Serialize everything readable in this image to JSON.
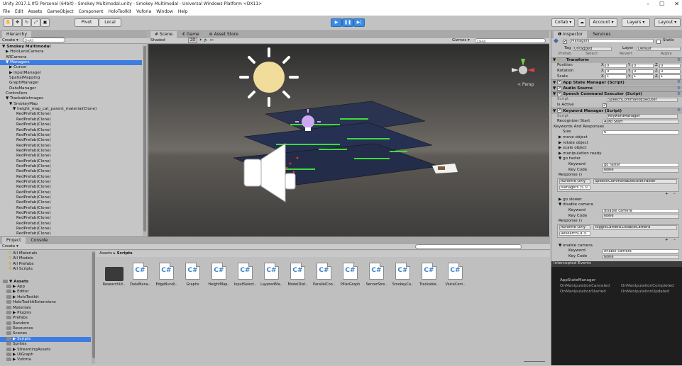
{
  "titlebar": {
    "title": "Unity 2017.1.0f3 Personal (64bit) - Smokey Multimodal.unity - Smokey Multimodal - Universal Windows Platform <DX11>",
    "min": "–",
    "max": "☐",
    "close": "✕"
  },
  "menu": [
    "File",
    "Edit",
    "Assets",
    "GameObject",
    "Component",
    "HoloToolkit",
    "Vuforia",
    "Window",
    "Help"
  ],
  "toolbar": {
    "pivot": "Pivot",
    "local": "Local",
    "collab": "Collab ▾",
    "account": "Account",
    "layers": "Layers",
    "layout": "Layout"
  },
  "hierarchy": {
    "tab": "Hierarchy",
    "create": "Create ▾",
    "search_placeholder": "Q▾All",
    "rows": [
      {
        "t": "▼ Smokey Multimodal",
        "ind": 0,
        "bold": true
      },
      {
        "t": "▶ HoloLensCamera",
        "ind": 1
      },
      {
        "t": "ARCamera",
        "ind": 1
      },
      {
        "t": "▼ Managers",
        "ind": 1,
        "sel": true
      },
      {
        "t": "▶ Cursor",
        "ind": 2
      },
      {
        "t": "▶ InputManager",
        "ind": 2
      },
      {
        "t": "SpatialMapping",
        "ind": 2
      },
      {
        "t": "GraphManager",
        "ind": 2
      },
      {
        "t": "DataManager",
        "ind": 2
      },
      {
        "t": "Controllers",
        "ind": 1
      },
      {
        "t": "▼ TrackableImages",
        "ind": 1
      },
      {
        "t": "▼ SmokeyMap",
        "ind": 2
      },
      {
        "t": "▼ height_map_cat_parent_material(Clone)",
        "ind": 3
      },
      {
        "t": "RedPrefab(Clone)",
        "ind": 4
      },
      {
        "t": "RedPrefab(Clone)",
        "ind": 4
      },
      {
        "t": "RedPrefab(Clone)",
        "ind": 4
      },
      {
        "t": "RedPrefab(Clone)",
        "ind": 4
      },
      {
        "t": "RedPrefab(Clone)",
        "ind": 4
      },
      {
        "t": "RedPrefab(Clone)",
        "ind": 4
      },
      {
        "t": "RedPrefab(Clone)",
        "ind": 4
      },
      {
        "t": "RedPrefab(Clone)",
        "ind": 4
      },
      {
        "t": "RedPrefab(Clone)",
        "ind": 4
      },
      {
        "t": "RedPrefab(Clone)",
        "ind": 4
      },
      {
        "t": "RedPrefab(Clone)",
        "ind": 4
      },
      {
        "t": "RedPrefab(Clone)",
        "ind": 4
      },
      {
        "t": "RedPrefab(Clone)",
        "ind": 4
      },
      {
        "t": "RedPrefab(Clone)",
        "ind": 4
      },
      {
        "t": "RedPrefab(Clone)",
        "ind": 4
      },
      {
        "t": "RedPrefab(Clone)",
        "ind": 4
      },
      {
        "t": "RedPrefab(Clone)",
        "ind": 4
      },
      {
        "t": "RedPrefab(Clone)",
        "ind": 4
      },
      {
        "t": "RedPrefab(Clone)",
        "ind": 4
      },
      {
        "t": "RedPrefab(Clone)",
        "ind": 4
      },
      {
        "t": "RedPrefab(Clone)",
        "ind": 4
      },
      {
        "t": "RedPrefab(Clone)",
        "ind": 4
      },
      {
        "t": "RedPrefab(Clone)",
        "ind": 4
      },
      {
        "t": "RedPrefab(Clone)",
        "ind": 4
      }
    ]
  },
  "scene": {
    "tabs": [
      "# Scene",
      "€ Game",
      "⊚ Asset Store"
    ],
    "shading": "Shaded",
    "mode2d": "2D",
    "gizmos": "Gizmos ▾",
    "search_placeholder": "Q▾All",
    "persp": "< Persp"
  },
  "project": {
    "tabs": [
      "Project",
      "Console"
    ],
    "create": "Create ▾",
    "favorites": [
      "All Materials",
      "All Models",
      "All Prefabs",
      "All Scripts"
    ],
    "tree": [
      {
        "t": "▼ Assets",
        "ind": 0,
        "bold": true
      },
      {
        "t": "▶ App",
        "ind": 1
      },
      {
        "t": "▶ Editor",
        "ind": 1
      },
      {
        "t": "▶ HoloToolkit",
        "ind": 1
      },
      {
        "t": "HoloToolkitExtensions",
        "ind": 1
      },
      {
        "t": "Materials",
        "ind": 1
      },
      {
        "t": "▶ Plugins",
        "ind": 1
      },
      {
        "t": "Prefabs",
        "ind": 1
      },
      {
        "t": "Random",
        "ind": 1
      },
      {
        "t": "Resources",
        "ind": 1
      },
      {
        "t": "Scenes",
        "ind": 1
      },
      {
        "t": "▶ Scripts",
        "ind": 1,
        "sel": true
      },
      {
        "t": "Sprites",
        "ind": 1
      },
      {
        "t": "▶ StreamingAssets",
        "ind": 1
      },
      {
        "t": "▶ UIGraph",
        "ind": 1
      },
      {
        "t": "▶ Vuforia",
        "ind": 1
      }
    ],
    "breadcrumb_root": "Assets",
    "breadcrumb_sep": "▸",
    "breadcrumb_current": "Scripts",
    "files": [
      "ResearchUt..",
      "DataMana..",
      "EdgeBundl..",
      "Graphs",
      "HeightMap..",
      "InputSelect..",
      "LayeredMa..",
      "ModelDist..",
      "ParallelCoo..",
      "PillarGraph",
      "ServerStre..",
      "SmokeyCa..",
      "Trackable..",
      "VoiceCom.."
    ]
  },
  "inspector": {
    "tabs": [
      "❶ Inspector",
      "Services"
    ],
    "name": "Managers",
    "static": "Static",
    "tag_label": "Tag",
    "tag": "Untagged",
    "layer_label": "Layer",
    "layer": "Default",
    "prefab": "Prefab",
    "select": "Select",
    "revert": "Revert",
    "apply": "Apply",
    "transform": {
      "title": "Transform",
      "rows": [
        {
          "l": "Position",
          "x": "0",
          "y": "0",
          "z": "0"
        },
        {
          "l": "Rotation",
          "x": "0",
          "y": "0",
          "z": "0"
        },
        {
          "l": "Scale",
          "x": "1",
          "y": "1",
          "z": "1"
        }
      ]
    },
    "app_state": "App State Manager (Script)",
    "audio": "Audio Source",
    "speech": "Speech Command Executer (Script)",
    "script_label": "Script",
    "speech_script": "SpeechCommandExecuter",
    "is_active": "Is Active",
    "keyword": "Keyword Manager (Script)",
    "keyword_script": "KeywordManager",
    "recognizer_label": "Recognizer Start",
    "recognizer": "Auto Start",
    "kar": "Keywords And Responses",
    "size_label": "Size",
    "size": "6",
    "items1": [
      "▶ move object",
      "▶ rotate object",
      "▶ scale object",
      "▶ manipulation ready",
      "▼ go faster"
    ],
    "kw_label": "Keyword",
    "keycode_label": "Key Code",
    "resp_label": "Response ()",
    "goFaster": {
      "kw": "go faster",
      "key": "None",
      "runtime": "Runtime Only",
      "fn": "SpeechCommandExecuter.Faster",
      "obj": "Managers (S ⊙"
    },
    "items2": [
      "▶ go slower",
      "▼ disable camera"
    ],
    "disableCam": {
      "kw": "disable camera",
      "key": "None",
      "runtime": "Runtime Only",
      "fn": "ToggleCamera.DisableCamera",
      "obj": "ResearchCa ⊙"
    },
    "enable": "▼ enable camera",
    "enableKw": "enable camera",
    "enableKey": "None",
    "intercepted": "Intercepted Events",
    "ev_title": "AppStateManager",
    "events": [
      "OnManipulationCanceled",
      "OnManipulationCompleted",
      "OnManipulationStarted",
      "OnManipulationUpdated"
    ]
  }
}
